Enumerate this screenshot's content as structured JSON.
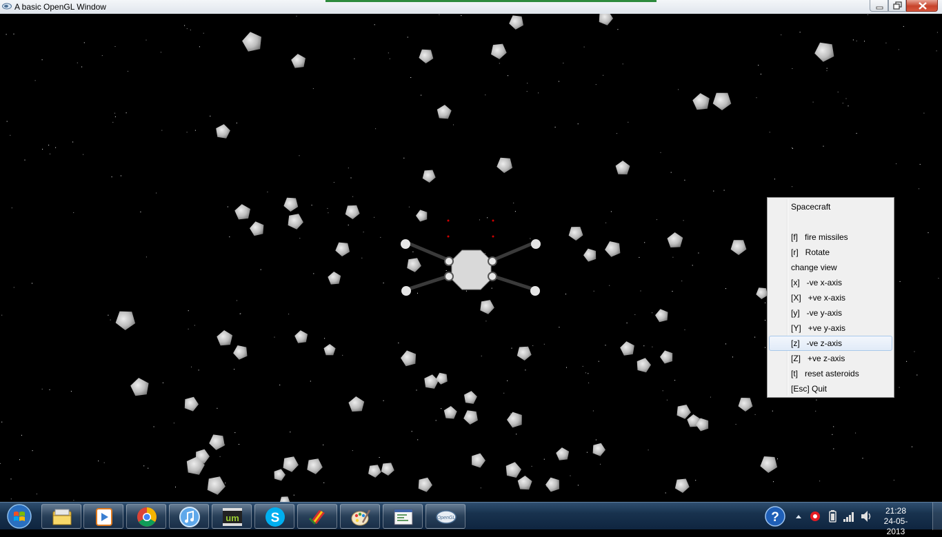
{
  "window": {
    "title": "A basic OpenGL Window"
  },
  "context_menu": {
    "header": "Spacecraft",
    "items": [
      {
        "label": "[f]   fire missiles"
      },
      {
        "label": "[r]   Rotate"
      },
      {
        "label": "change view"
      },
      {
        "label": "[x]   -ve x-axis"
      },
      {
        "label": "[X]   +ve x-axis"
      },
      {
        "label": "[y]   -ve y-axis"
      },
      {
        "label": "[Y]   +ve y-axis"
      },
      {
        "label": "[z]   -ve z-axis"
      },
      {
        "label": "[Z]   +ve z-axis"
      },
      {
        "label": "[t]   reset asteroids"
      },
      {
        "label": "[Esc] Quit"
      }
    ],
    "highlighted_item": "[z]   -ve z-axis"
  },
  "taskbar": {
    "start_icon": "windows-start-icon",
    "pinned": [
      {
        "name": "windows-explorer-icon"
      },
      {
        "name": "media-player-icon"
      },
      {
        "name": "chrome-icon"
      },
      {
        "name": "itunes-icon"
      },
      {
        "name": "ultramixer-icon"
      },
      {
        "name": "skype-icon"
      },
      {
        "name": "winzip-icon"
      },
      {
        "name": "paint-icon"
      },
      {
        "name": "code-editor-icon"
      },
      {
        "name": "opengl-icon"
      }
    ],
    "tray_icons": [
      "help-icon",
      "show-hidden-icons-chevron",
      "beats-audio-icon",
      "battery-icon",
      "network-signal-icon",
      "volume-icon"
    ],
    "clock": {
      "time": "21:28",
      "date": "24-05-2013"
    }
  },
  "colors": {
    "space_background": "#000000",
    "asteroid": "#cfcfcf",
    "spacecraft_body": "#d8d8d8",
    "missile_dot": "#cc0000",
    "menu_highlight": "#e1ebf8",
    "taskbar": "#1b3654"
  }
}
